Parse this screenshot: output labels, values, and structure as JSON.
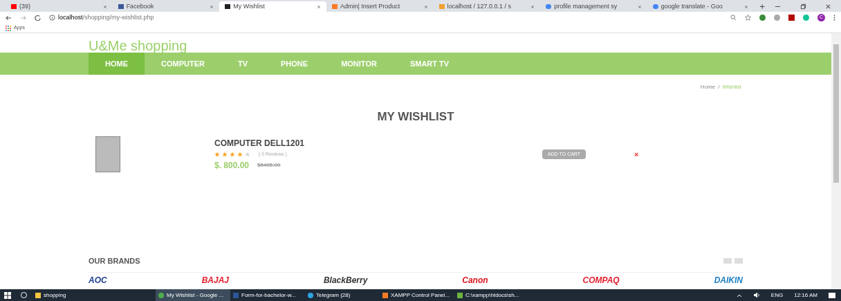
{
  "browser": {
    "tabs": [
      {
        "title": "(39)",
        "kind": "youtube",
        "selected": false
      },
      {
        "title": "Facebook",
        "kind": "facebook",
        "selected": false
      },
      {
        "title": "My Wishlist",
        "kind": "site",
        "selected": true
      },
      {
        "title": "Admin| Insert Product",
        "kind": "xampp",
        "selected": false
      },
      {
        "title": "localhost / 127.0.0.1 / s",
        "kind": "pma",
        "selected": false
      },
      {
        "title": "profile management sy",
        "kind": "google",
        "selected": false
      },
      {
        "title": "google translate - Goo",
        "kind": "google",
        "selected": false
      }
    ],
    "url_host": "localhost",
    "url_path": "/shopping/my-wishlist.php",
    "profile_initial": "C",
    "bookmarks": [
      "Apps"
    ]
  },
  "site": {
    "title": "U&Me shopping",
    "nav": [
      {
        "label": "HOME",
        "selected": true
      },
      {
        "label": "COMPUTER",
        "selected": false
      },
      {
        "label": "TV",
        "selected": false
      },
      {
        "label": "PHONE",
        "selected": false
      },
      {
        "label": "MONITOR",
        "selected": false
      },
      {
        "label": "SMART TV",
        "selected": false
      }
    ],
    "breadcrumb": [
      "Home",
      "/",
      "Wishlist"
    ],
    "heading": "MY WISHLIST",
    "items": [
      {
        "name": "COMPUTER DELL1201",
        "stars": 4,
        "reviews": "( 0 Reviews )",
        "price": "$. 800.00",
        "old_price": "$5405.00",
        "button": "ADD TO CART",
        "remove": "×"
      }
    ],
    "brands_heading": "OUR BRANDS",
    "brands": [
      {
        "name": "AOC",
        "color": "#1d3f8f"
      },
      {
        "name": "BAJAJ",
        "color": "#e3202e"
      },
      {
        "name": "BlackBerry",
        "color": "#333333"
      },
      {
        "name": "Canon",
        "color": "#d9141b"
      },
      {
        "name": "COMPAQ",
        "color": "#e3202e"
      },
      {
        "name": "DAIKIN",
        "color": "#1b7fc3"
      }
    ]
  },
  "taskbar": {
    "items": [
      {
        "label": "shopping",
        "kind": "folder",
        "selected": false
      },
      {
        "label": "My Wishlist - Google ...",
        "kind": "chrome",
        "selected": true
      },
      {
        "label": "Form-for-bachelor-w...",
        "kind": "word",
        "selected": false
      },
      {
        "label": "Telegram (28)",
        "kind": "telegram",
        "selected": false
      },
      {
        "label": "XAMPP Control Panel...",
        "kind": "xampp",
        "selected": false
      },
      {
        "label": "C:\\xampp\\htdocs\\sh...",
        "kind": "notepad",
        "selected": false
      }
    ],
    "language": "ENG",
    "time": "12:16 AM"
  }
}
